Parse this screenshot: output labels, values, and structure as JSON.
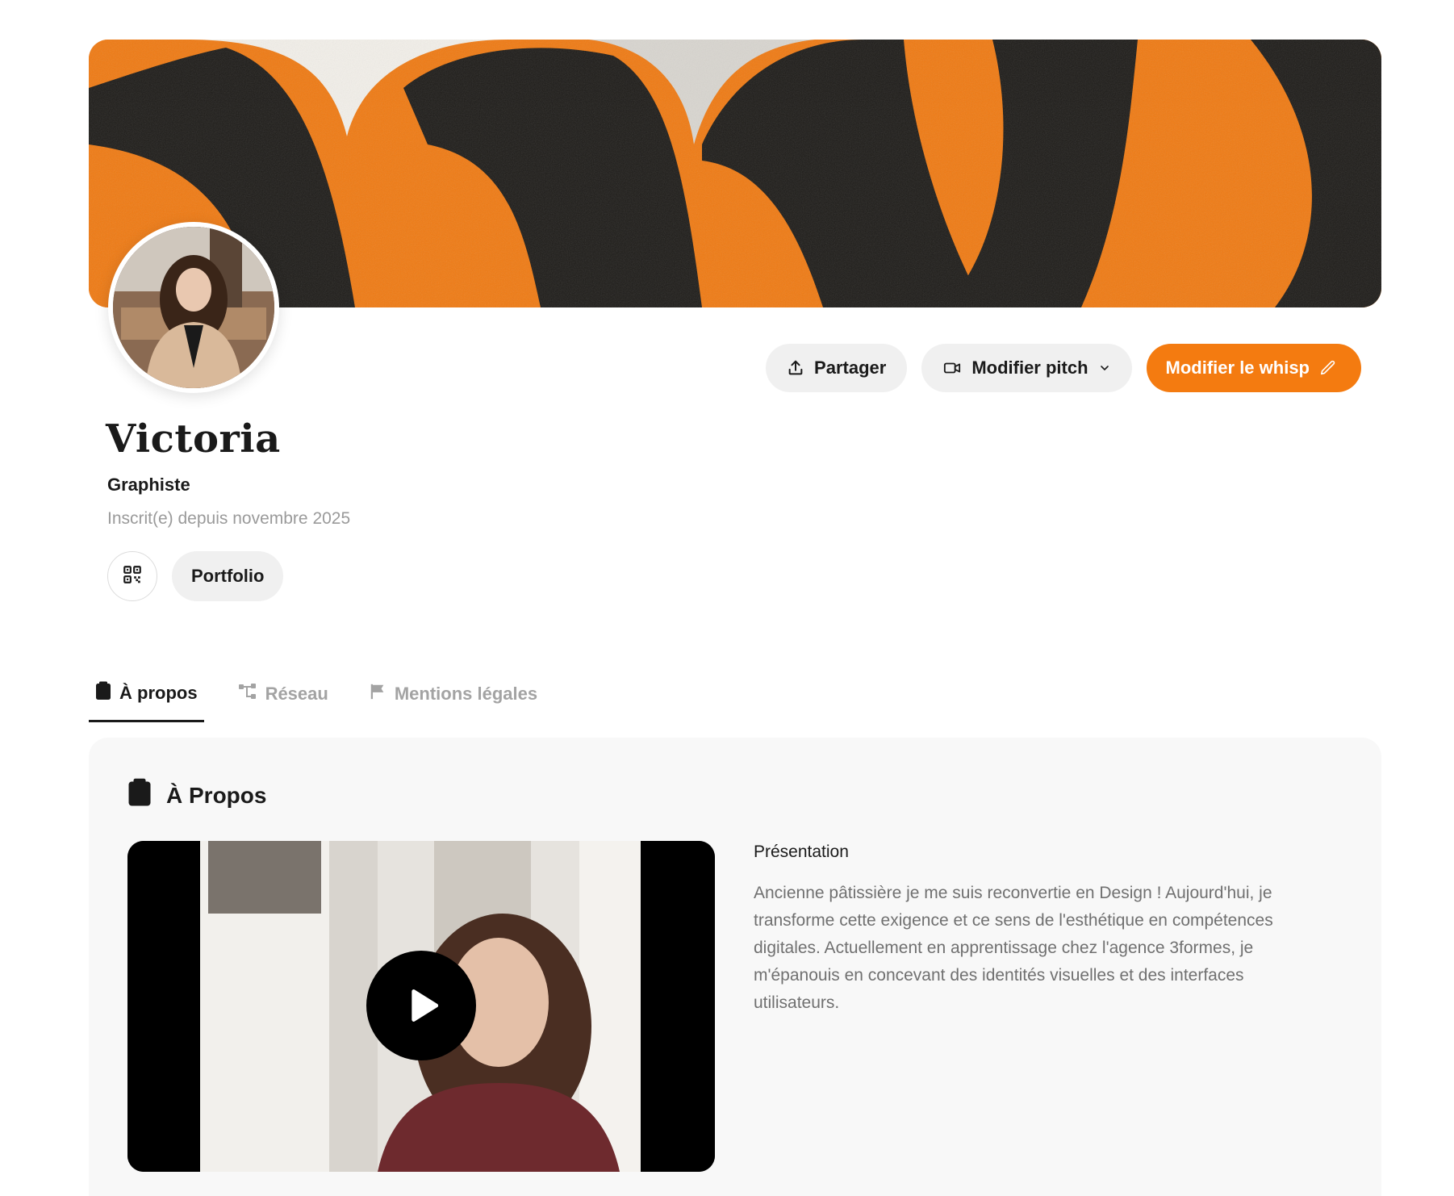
{
  "colors": {
    "accent": "#f47b10",
    "text": "#1a1a1a",
    "muted": "#9a9a9a",
    "pill_bg": "#f0f0f0",
    "panel_bg": "#f8f8f8"
  },
  "header": {
    "share_label": "Partager",
    "share_icon": "upload-icon",
    "pitch_label": "Modifier pitch",
    "pitch_icon": "video-camera-icon",
    "pitch_chevron_icon": "chevron-down-icon",
    "edit_label": "Modifier le whisp",
    "edit_icon": "pencil-icon"
  },
  "profile": {
    "name": "Victoria",
    "role": "Graphiste",
    "member_since": "Inscrit(e) depuis novembre 2025",
    "qr_icon": "qr-code-icon",
    "portfolio_label": "Portfolio"
  },
  "tabs": [
    {
      "label": "À propos",
      "icon": "clipboard-icon",
      "active": true
    },
    {
      "label": "Réseau",
      "icon": "network-icon",
      "active": false
    },
    {
      "label": "Mentions légales",
      "icon": "flag-icon",
      "active": false
    }
  ],
  "about": {
    "title": "À Propos",
    "title_icon": "clipboard-icon",
    "video_play_icon": "play-icon",
    "presentation_label": "Présentation",
    "presentation_text": "Ancienne pâtissière je me suis reconvertie en Design ! Aujourd'hui, je transforme cette exigence et ce sens de l'esthétique en compétences digitales. Actuellement en apprentissage chez l'agence 3formes, je m'épanouis en concevant des identités visuelles et des interfaces utilisateurs."
  }
}
